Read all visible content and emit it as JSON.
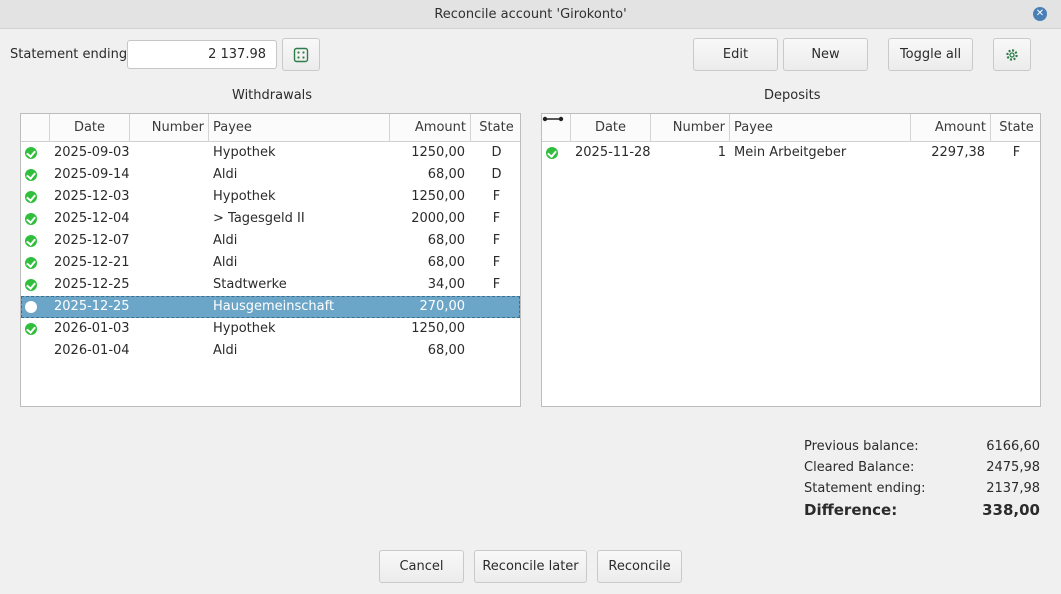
{
  "window": {
    "title": "Reconcile account 'Girokonto'"
  },
  "statement": {
    "label": "Statement ending:",
    "value": "2 137.98"
  },
  "toolbar": {
    "edit": "Edit",
    "new": "New",
    "toggle_all": "Toggle all"
  },
  "withdrawals": {
    "title": "Withdrawals",
    "headers": {
      "date": "Date",
      "number": "Number",
      "payee": "Payee",
      "amount": "Amount",
      "state": "State"
    },
    "rows": [
      {
        "date": "2025-09-03",
        "number": "",
        "payee": "Hypothek",
        "amount": "1250,00",
        "state": "D",
        "mark": "check"
      },
      {
        "date": "2025-09-14",
        "number": "",
        "payee": "Aldi",
        "amount": "68,00",
        "state": "D",
        "mark": "check"
      },
      {
        "date": "2025-12-03",
        "number": "",
        "payee": "Hypothek",
        "amount": "1250,00",
        "state": "F",
        "mark": "check"
      },
      {
        "date": "2025-12-04",
        "number": "",
        "payee": "> Tagesgeld II",
        "amount": "2000,00",
        "state": "F",
        "mark": "check"
      },
      {
        "date": "2025-12-07",
        "number": "",
        "payee": "Aldi",
        "amount": "68,00",
        "state": "F",
        "mark": "check"
      },
      {
        "date": "2025-12-21",
        "number": "",
        "payee": "Aldi",
        "amount": "68,00",
        "state": "F",
        "mark": "check"
      },
      {
        "date": "2025-12-25",
        "number": "",
        "payee": "Stadtwerke",
        "amount": "34,00",
        "state": "F",
        "mark": "check"
      },
      {
        "date": "2025-12-25",
        "number": "",
        "payee": "Hausgemeinschaft",
        "amount": "270,00",
        "state": "",
        "mark": "empty"
      },
      {
        "date": "2026-01-03",
        "number": "",
        "payee": "Hypothek",
        "amount": "1250,00",
        "state": "",
        "mark": "check"
      },
      {
        "date": "2026-01-04",
        "number": "",
        "payee": "Aldi",
        "amount": "68,00",
        "state": "",
        "mark": "none"
      }
    ]
  },
  "deposits": {
    "title": "Deposits",
    "headers": {
      "date": "Date",
      "number": "Number",
      "payee": "Payee",
      "amount": "Amount",
      "state": "State"
    },
    "rows": [
      {
        "date": "2025-11-28",
        "number": "1",
        "payee": "Mein Arbeitgeber",
        "amount": "2297,38",
        "state": "F",
        "mark": "check"
      }
    ]
  },
  "summary": {
    "previous_label": "Previous balance:",
    "previous_value": "6166,60",
    "cleared_label": "Cleared Balance:",
    "cleared_value": "2475,98",
    "statement_label": "Statement ending:",
    "statement_value": "2137,98",
    "difference_label": "Difference:",
    "difference_value": "338,00"
  },
  "buttons": {
    "cancel": "Cancel",
    "reconcile_later": "Reconcile later",
    "reconcile": "Reconcile"
  },
  "colors": {
    "selection": "#6ba6c9",
    "check": "#2fbf3c",
    "close": "#4a7fb5"
  }
}
